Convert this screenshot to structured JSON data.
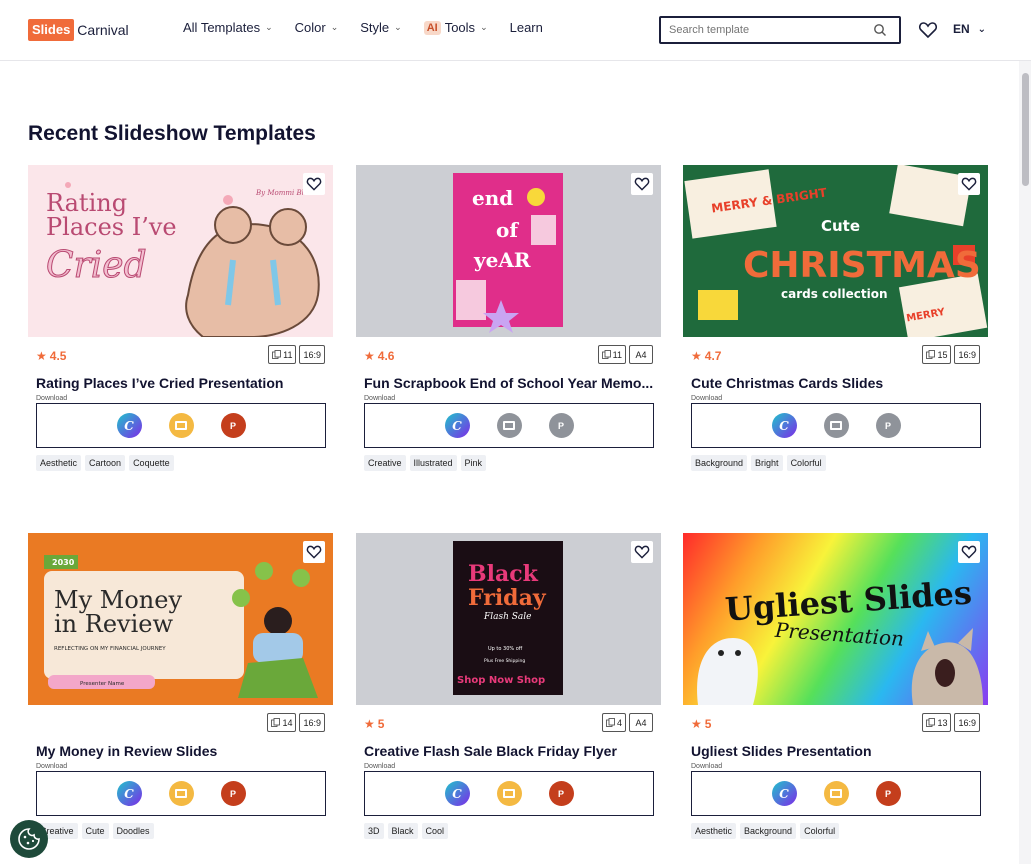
{
  "header": {
    "logo_slides": "Slides",
    "logo_carnival": "Carnival",
    "nav": [
      {
        "label": "All Templates"
      },
      {
        "label": "Color"
      },
      {
        "label": "Style"
      },
      {
        "label": "Tools",
        "badge": "AI"
      },
      {
        "label": "Learn"
      }
    ],
    "search_placeholder": "Search template",
    "lang": "EN"
  },
  "section_title": "Recent Slideshow Templates",
  "download_label": "Download",
  "cards": [
    {
      "rating": "4.5",
      "slides": "11",
      "ratio": "16:9",
      "title": "Rating Places I’ve Cried Presentation",
      "formats": [
        "canva",
        "gslides",
        "ppt"
      ],
      "tags": [
        "Aesthetic",
        "Cartoon",
        "Coquette"
      ],
      "thumb": {
        "line1": "Rating",
        "line2": "Places I’ve",
        "line3": "Cried",
        "byline": "By Mommi Bh"
      }
    },
    {
      "rating": "4.6",
      "slides": "11",
      "ratio": "A4",
      "title": "Fun Scrapbook End of School Year Memo...",
      "formats": [
        "canva",
        "gslides-grey",
        "ppt-grey"
      ],
      "tags": [
        "Creative",
        "Illustrated",
        "Pink"
      ],
      "thumb": {
        "line1": "end",
        "line2": "of",
        "line3": "yeAR"
      }
    },
    {
      "rating": "4.7",
      "slides": "15",
      "ratio": "16:9",
      "title": "Cute Christmas Cards Slides",
      "formats": [
        "canva",
        "gslides-grey",
        "ppt-grey"
      ],
      "tags": [
        "Background",
        "Bright",
        "Colorful"
      ],
      "thumb": {
        "line1": "Cute",
        "line2": "CHRISTMAS",
        "line3": "cards collection",
        "tag1": "MERRY & BRIGHT",
        "tag2": "MERRY"
      }
    },
    {
      "rating": "",
      "slides": "14",
      "ratio": "16:9",
      "title": "My Money in Review Slides",
      "formats": [
        "canva",
        "gslides",
        "ppt"
      ],
      "tags": [
        "Creative",
        "Cute",
        "Doodles"
      ],
      "thumb": {
        "year": "2030",
        "line1": "My Money",
        "line2": "in Review",
        "sub": "REFLECTING ON MY FINANCIAL JOURNEY",
        "presenter": "Presenter Name"
      }
    },
    {
      "rating": "5",
      "slides": "4",
      "ratio": "A4",
      "title": "Creative Flash Sale Black Friday Flyer",
      "formats": [
        "canva",
        "gslides",
        "ppt"
      ],
      "tags": [
        "3D",
        "Black",
        "Cool"
      ],
      "thumb": {
        "line1": "Black",
        "line2": "Friday",
        "line3": "Flash Sale",
        "offer": "Up to 30% off",
        "shipping": "Plus Free Shipping",
        "footer": "Shop Now Shop"
      }
    },
    {
      "rating": "5",
      "slides": "13",
      "ratio": "16:9",
      "title": "Ugliest Slides Presentation",
      "formats": [
        "canva",
        "gslides",
        "ppt"
      ],
      "tags": [
        "Aesthetic",
        "Background",
        "Colorful"
      ],
      "thumb": {
        "line1": "Ugliest Slides",
        "line2": "Presentation"
      }
    }
  ],
  "colors": {
    "accent": "#f06b3a",
    "navy": "#1b1f3b"
  }
}
